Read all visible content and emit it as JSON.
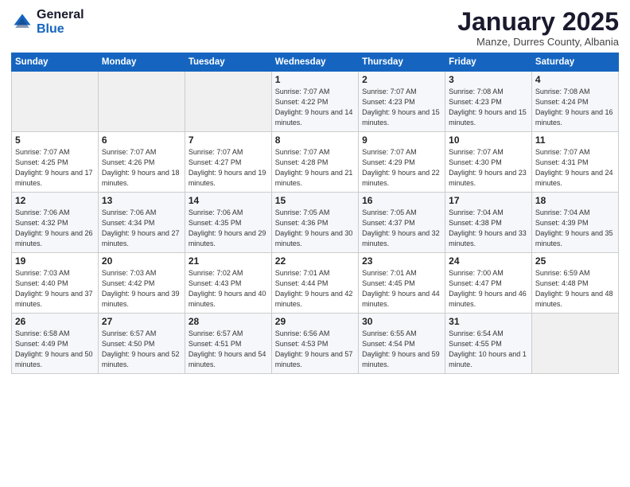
{
  "header": {
    "logo_general": "General",
    "logo_blue": "Blue",
    "month_title": "January 2025",
    "subtitle": "Manze, Durres County, Albania"
  },
  "weekdays": [
    "Sunday",
    "Monday",
    "Tuesday",
    "Wednesday",
    "Thursday",
    "Friday",
    "Saturday"
  ],
  "weeks": [
    [
      {
        "day": "",
        "sunrise": "",
        "sunset": "",
        "daylight": ""
      },
      {
        "day": "",
        "sunrise": "",
        "sunset": "",
        "daylight": ""
      },
      {
        "day": "",
        "sunrise": "",
        "sunset": "",
        "daylight": ""
      },
      {
        "day": "1",
        "sunrise": "Sunrise: 7:07 AM",
        "sunset": "Sunset: 4:22 PM",
        "daylight": "Daylight: 9 hours and 14 minutes."
      },
      {
        "day": "2",
        "sunrise": "Sunrise: 7:07 AM",
        "sunset": "Sunset: 4:23 PM",
        "daylight": "Daylight: 9 hours and 15 minutes."
      },
      {
        "day": "3",
        "sunrise": "Sunrise: 7:08 AM",
        "sunset": "Sunset: 4:23 PM",
        "daylight": "Daylight: 9 hours and 15 minutes."
      },
      {
        "day": "4",
        "sunrise": "Sunrise: 7:08 AM",
        "sunset": "Sunset: 4:24 PM",
        "daylight": "Daylight: 9 hours and 16 minutes."
      }
    ],
    [
      {
        "day": "5",
        "sunrise": "Sunrise: 7:07 AM",
        "sunset": "Sunset: 4:25 PM",
        "daylight": "Daylight: 9 hours and 17 minutes."
      },
      {
        "day": "6",
        "sunrise": "Sunrise: 7:07 AM",
        "sunset": "Sunset: 4:26 PM",
        "daylight": "Daylight: 9 hours and 18 minutes."
      },
      {
        "day": "7",
        "sunrise": "Sunrise: 7:07 AM",
        "sunset": "Sunset: 4:27 PM",
        "daylight": "Daylight: 9 hours and 19 minutes."
      },
      {
        "day": "8",
        "sunrise": "Sunrise: 7:07 AM",
        "sunset": "Sunset: 4:28 PM",
        "daylight": "Daylight: 9 hours and 21 minutes."
      },
      {
        "day": "9",
        "sunrise": "Sunrise: 7:07 AM",
        "sunset": "Sunset: 4:29 PM",
        "daylight": "Daylight: 9 hours and 22 minutes."
      },
      {
        "day": "10",
        "sunrise": "Sunrise: 7:07 AM",
        "sunset": "Sunset: 4:30 PM",
        "daylight": "Daylight: 9 hours and 23 minutes."
      },
      {
        "day": "11",
        "sunrise": "Sunrise: 7:07 AM",
        "sunset": "Sunset: 4:31 PM",
        "daylight": "Daylight: 9 hours and 24 minutes."
      }
    ],
    [
      {
        "day": "12",
        "sunrise": "Sunrise: 7:06 AM",
        "sunset": "Sunset: 4:32 PM",
        "daylight": "Daylight: 9 hours and 26 minutes."
      },
      {
        "day": "13",
        "sunrise": "Sunrise: 7:06 AM",
        "sunset": "Sunset: 4:34 PM",
        "daylight": "Daylight: 9 hours and 27 minutes."
      },
      {
        "day": "14",
        "sunrise": "Sunrise: 7:06 AM",
        "sunset": "Sunset: 4:35 PM",
        "daylight": "Daylight: 9 hours and 29 minutes."
      },
      {
        "day": "15",
        "sunrise": "Sunrise: 7:05 AM",
        "sunset": "Sunset: 4:36 PM",
        "daylight": "Daylight: 9 hours and 30 minutes."
      },
      {
        "day": "16",
        "sunrise": "Sunrise: 7:05 AM",
        "sunset": "Sunset: 4:37 PM",
        "daylight": "Daylight: 9 hours and 32 minutes."
      },
      {
        "day": "17",
        "sunrise": "Sunrise: 7:04 AM",
        "sunset": "Sunset: 4:38 PM",
        "daylight": "Daylight: 9 hours and 33 minutes."
      },
      {
        "day": "18",
        "sunrise": "Sunrise: 7:04 AM",
        "sunset": "Sunset: 4:39 PM",
        "daylight": "Daylight: 9 hours and 35 minutes."
      }
    ],
    [
      {
        "day": "19",
        "sunrise": "Sunrise: 7:03 AM",
        "sunset": "Sunset: 4:40 PM",
        "daylight": "Daylight: 9 hours and 37 minutes."
      },
      {
        "day": "20",
        "sunrise": "Sunrise: 7:03 AM",
        "sunset": "Sunset: 4:42 PM",
        "daylight": "Daylight: 9 hours and 39 minutes."
      },
      {
        "day": "21",
        "sunrise": "Sunrise: 7:02 AM",
        "sunset": "Sunset: 4:43 PM",
        "daylight": "Daylight: 9 hours and 40 minutes."
      },
      {
        "day": "22",
        "sunrise": "Sunrise: 7:01 AM",
        "sunset": "Sunset: 4:44 PM",
        "daylight": "Daylight: 9 hours and 42 minutes."
      },
      {
        "day": "23",
        "sunrise": "Sunrise: 7:01 AM",
        "sunset": "Sunset: 4:45 PM",
        "daylight": "Daylight: 9 hours and 44 minutes."
      },
      {
        "day": "24",
        "sunrise": "Sunrise: 7:00 AM",
        "sunset": "Sunset: 4:47 PM",
        "daylight": "Daylight: 9 hours and 46 minutes."
      },
      {
        "day": "25",
        "sunrise": "Sunrise: 6:59 AM",
        "sunset": "Sunset: 4:48 PM",
        "daylight": "Daylight: 9 hours and 48 minutes."
      }
    ],
    [
      {
        "day": "26",
        "sunrise": "Sunrise: 6:58 AM",
        "sunset": "Sunset: 4:49 PM",
        "daylight": "Daylight: 9 hours and 50 minutes."
      },
      {
        "day": "27",
        "sunrise": "Sunrise: 6:57 AM",
        "sunset": "Sunset: 4:50 PM",
        "daylight": "Daylight: 9 hours and 52 minutes."
      },
      {
        "day": "28",
        "sunrise": "Sunrise: 6:57 AM",
        "sunset": "Sunset: 4:51 PM",
        "daylight": "Daylight: 9 hours and 54 minutes."
      },
      {
        "day": "29",
        "sunrise": "Sunrise: 6:56 AM",
        "sunset": "Sunset: 4:53 PM",
        "daylight": "Daylight: 9 hours and 57 minutes."
      },
      {
        "day": "30",
        "sunrise": "Sunrise: 6:55 AM",
        "sunset": "Sunset: 4:54 PM",
        "daylight": "Daylight: 9 hours and 59 minutes."
      },
      {
        "day": "31",
        "sunrise": "Sunrise: 6:54 AM",
        "sunset": "Sunset: 4:55 PM",
        "daylight": "Daylight: 10 hours and 1 minute."
      },
      {
        "day": "",
        "sunrise": "",
        "sunset": "",
        "daylight": ""
      }
    ]
  ]
}
